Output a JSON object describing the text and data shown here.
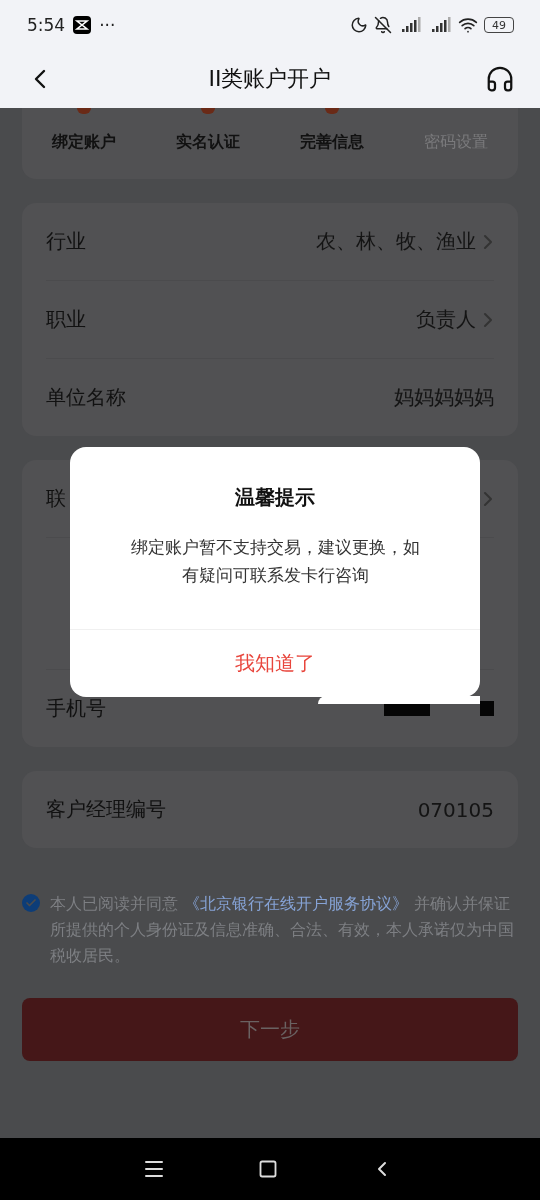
{
  "status_bar": {
    "time": "5:54",
    "more": "···",
    "battery": "49"
  },
  "header": {
    "title": "II类账户开户"
  },
  "steps": [
    {
      "label": "绑定账户",
      "done": true
    },
    {
      "label": "实名认证",
      "done": true
    },
    {
      "label": "完善信息",
      "done": true
    },
    {
      "label": "密码设置",
      "done": false
    }
  ],
  "form_groups": [
    {
      "rows": [
        {
          "kind": "select",
          "label": "行业",
          "value": "农、林、牧、渔业"
        },
        {
          "kind": "select",
          "label": "职业",
          "value": "负责人"
        },
        {
          "kind": "text",
          "label": "单位名称",
          "value": "妈妈妈妈妈"
        }
      ]
    },
    {
      "rows": [
        {
          "kind": "select",
          "label": "联"
        },
        {
          "kind": "redacted",
          "label": "手机号"
        }
      ]
    },
    {
      "rows": [
        {
          "kind": "text",
          "label": "客户经理编号",
          "value": "070105"
        }
      ]
    }
  ],
  "agreement": {
    "checked": true,
    "text_before": "本人已阅读并同意",
    "link": "《北京银行在线开户服务协议》",
    "text_after": "并确认并保证所提供的个人身份证及信息准确、合法、有效，本人承诺仅为中国税收居民。"
  },
  "next_button": {
    "label": "下一步",
    "disabled": true
  },
  "dialog": {
    "title": "温馨提示",
    "message": "绑定账户暂不支持交易，建议更换，如有疑问可联系发卡行咨询",
    "confirm": "我知道了"
  }
}
